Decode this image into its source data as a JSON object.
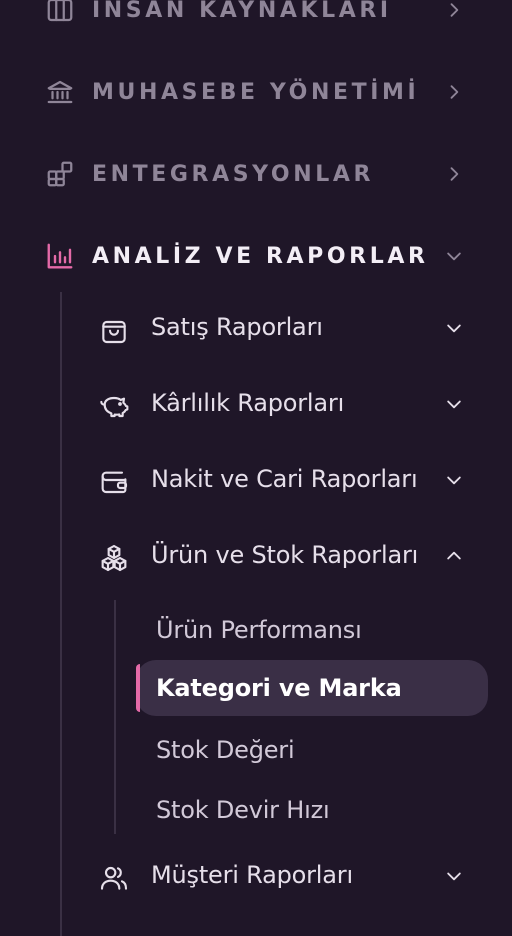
{
  "nav": {
    "sections": [
      {
        "key": "hr",
        "label": "İNSAN KAYNAKLARI",
        "icon": "columns-icon",
        "expanded": false
      },
      {
        "key": "acc",
        "label": "MUHASEBE YÖNETİMİ",
        "icon": "bank-icon",
        "expanded": false
      },
      {
        "key": "int",
        "label": "ENTEGRASYONLAR",
        "icon": "blocks-icon",
        "expanded": false
      },
      {
        "key": "rep",
        "label": "ANALİZ VE RAPORLAR",
        "icon": "bar-chart-icon",
        "expanded": true
      }
    ],
    "reports": {
      "items": [
        {
          "label": "Satış Raporları",
          "icon": "shopping-bag-icon",
          "expanded": false
        },
        {
          "label": "Kârlılık Raporları",
          "icon": "piggy-bank-icon",
          "expanded": false
        },
        {
          "label": "Nakit ve Cari Raporları",
          "icon": "wallet-icon",
          "expanded": false
        },
        {
          "label": "Ürün ve Stok Raporları",
          "icon": "boxes-icon",
          "expanded": true
        },
        {
          "label": "Müşteri Raporları",
          "icon": "users-icon",
          "expanded": false
        }
      ],
      "stock_children": [
        {
          "label": "Ürün Performansı",
          "active": false
        },
        {
          "label": "Kategori ve Marka",
          "active": true
        },
        {
          "label": "Stok Değeri",
          "active": false
        },
        {
          "label": "Stok Devir Hızı",
          "active": false
        }
      ]
    }
  },
  "colors": {
    "background": "#1f1628",
    "accent": "#e46aa8",
    "active_bg": "#3a2f46",
    "muted_text": "#8f8598"
  }
}
